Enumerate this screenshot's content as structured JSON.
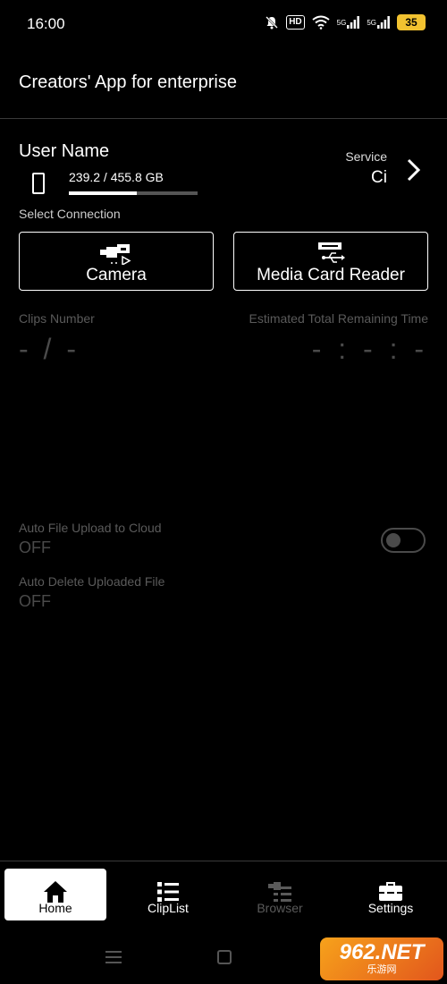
{
  "status_bar": {
    "time": "16:00",
    "icons": [
      "bell-off-icon",
      "hd-icon",
      "wifi-icon",
      "signal-5g-icon",
      "signal-5g-icon",
      "battery-icon"
    ],
    "hd_label": "HD",
    "network_1": "5G",
    "network_2": "5G",
    "battery_level": "35",
    "battery_color": "#f2c230"
  },
  "header": {
    "title": "Creators' App for enterprise"
  },
  "account": {
    "user_name": "User Name",
    "storage_text": "239.2 / 455.8 GB",
    "storage_used_fraction": 0.525,
    "service_label": "Service",
    "service_value": "Ci"
  },
  "connection": {
    "label": "Select Connection",
    "buttons": [
      {
        "label": "Camera",
        "icon": "camera-icon"
      },
      {
        "label": "Media Card Reader",
        "icon": "card-reader-icon"
      }
    ]
  },
  "stats": {
    "clips_label": "Clips Number",
    "clips_value": "- / -",
    "est_label": "Estimated Total Remaining Time",
    "est_value": "- : - : -"
  },
  "settings": {
    "auto_upload_label": "Auto File Upload to Cloud",
    "auto_upload_value": "OFF",
    "auto_upload_on": false,
    "auto_delete_label": "Auto Delete Uploaded File",
    "auto_delete_value": "OFF"
  },
  "nav": {
    "items": [
      {
        "label": "Home",
        "icon": "home-icon",
        "active": true
      },
      {
        "label": "ClipList",
        "icon": "list-icon",
        "active": false
      },
      {
        "label": "Browser",
        "icon": "browser-icon",
        "active": false,
        "disabled": true
      },
      {
        "label": "Settings",
        "icon": "toolbox-icon",
        "active": false
      }
    ]
  },
  "watermark": {
    "main": "962.NET",
    "sub": "乐游网"
  }
}
